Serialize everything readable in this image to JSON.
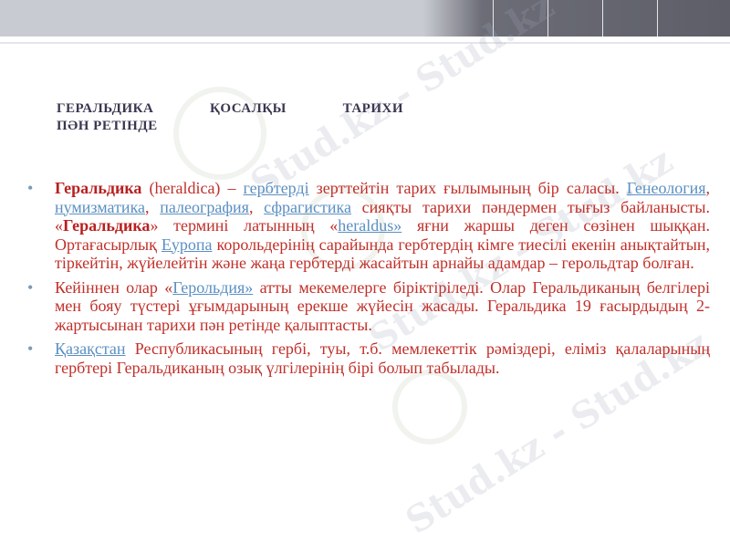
{
  "title": {
    "line1_word1": "ГЕРАЛЬДИКА",
    "line1_word2": "ҚОСАЛҚЫ",
    "line1_word3": "ТАРИХИ",
    "line2": "ПӘН РЕТІНДЕ"
  },
  "watermark": "Stud.kz - Stud.kz",
  "bullets": [
    {
      "p1_bold": "Геральдика",
      "p2": " (heraldica) – ",
      "link1": "гербтерді",
      "p3": " зерттейтін тарих ғылымының бір саласы. ",
      "link2": "Генеология",
      "p4": ", ",
      "link3": "нумизматика",
      "p5": ", ",
      "link4": "палеография",
      "p6": ", ",
      "link5": "сфрагистика",
      "p7": " сияқты тарихи пәндермен тығыз байланысты. «",
      "p8_bold": "Геральдика",
      "p9": "» термині латынның «",
      "link6": "heraldus»",
      "p10": " яғни жаршы деген сөзінен шыққан. Ортағасырлық ",
      "link7": "Еуропа",
      "p11": " корольдерінің сарайында гербтердің кімге тиесілі екенін анықтайтын, тіркейтін, жүйелейтін және жаңа гербтерді жасайтын арнайы адамдар – герольдтар болған."
    },
    {
      "p1": "Кейіннен олар «",
      "link1": "Герольдия»",
      "p2": " атты мекемелерге біріктіріледі. Олар Геральдиканың белгілері мен бояу түстері ұғымдарының ерекше жүйесін жасады. Геральдика 19 ғасырдыдың 2-жартысынан тарихи пән ретінде қалыптасты."
    },
    {
      "link1": "Қазақстан",
      "p1": " Республикасының гербі, туы, т.б. мемлекеттік рәміздері, еліміз қалаларының гербтері Геральдиканың озық үлгілерінің бірі болып табылады."
    }
  ],
  "bullet_glyph": "•"
}
